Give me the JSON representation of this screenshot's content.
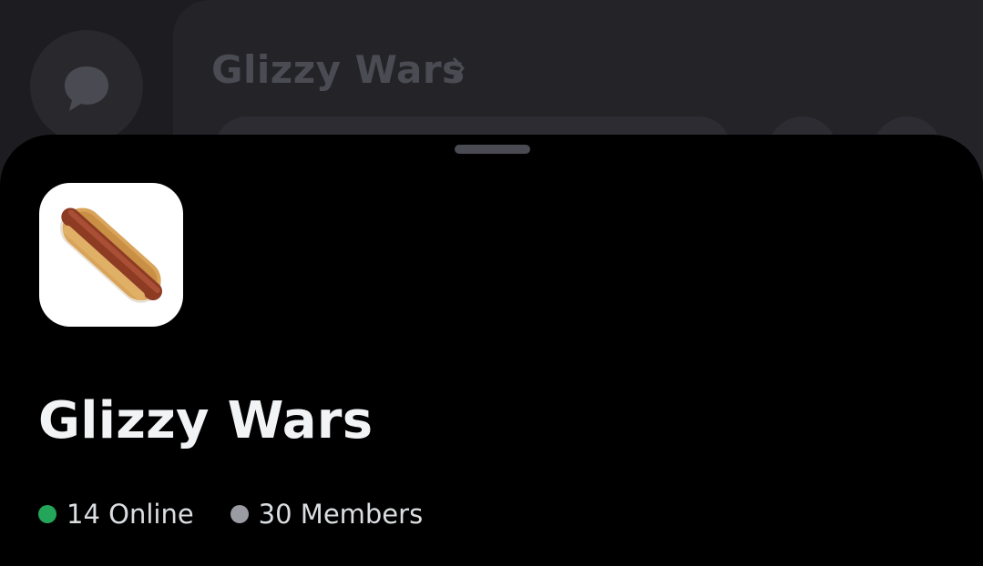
{
  "background": {
    "header_title": "Glizzy Wars",
    "dm_icon": "chat-bubble-icon",
    "chevron_icon": "chevron-right-icon"
  },
  "sheet": {
    "server_icon": "hotdog-icon",
    "server_name": "Glizzy Wars",
    "online_label": "14 Online",
    "members_label": "30 Members",
    "colors": {
      "online": "#23a55a",
      "members": "#9a9ba3",
      "sheet_bg": "#000000"
    }
  }
}
